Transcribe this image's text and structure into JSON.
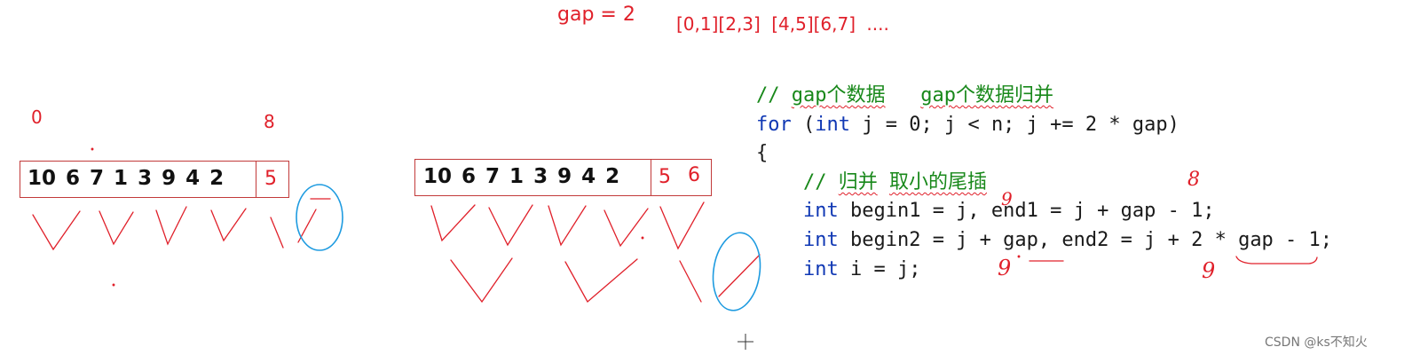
{
  "header": {
    "gap_label": "gap = 2",
    "ranges": [
      "[0,1]",
      "[2,3]",
      "[4,5]",
      "[6,7]",
      "...."
    ]
  },
  "indices": {
    "start": "0",
    "end": "8"
  },
  "array1": {
    "values": [
      "10",
      "6",
      "7",
      "1",
      "3",
      "9",
      "4",
      "2"
    ],
    "tail": [
      "5"
    ]
  },
  "array2": {
    "values": [
      "10",
      "6",
      "7",
      "1",
      "3",
      "9",
      "4",
      "2"
    ],
    "tail": [
      "5",
      "6"
    ]
  },
  "code": {
    "comment1_prefix": "// ",
    "comment1_a": "gap个数据",
    "comment1_sep": "   ",
    "comment1_b": "gap个数据归并",
    "for_kw": "for",
    "for_open": " (",
    "for_int": "int",
    "for_rest": " j = 0; j < n; j += 2 * gap)",
    "brace": "{",
    "comment2_prefix": "    // ",
    "comment2_a": "归并",
    "comment2_sep": " ",
    "comment2_b": "取小的尾插",
    "indent": "    ",
    "l4_int": "int",
    "l4_rest": " begin1 = j, end1 = j + gap - 1;",
    "l5_int": "int",
    "l5_rest": " begin2 = j + gap, end2 = j + 2 * gap - 1;",
    "l6_int": "int",
    "l6_rest": " i = j;"
  },
  "annotations": {
    "hand_8": "8",
    "hand_9a": "9",
    "hand_9b": "9",
    "hand_9c": "9"
  },
  "colors": {
    "ink_red": "#e0202a",
    "ink_blue": "#1e9be0",
    "comment_green": "#18881a",
    "keyword_blue": "#1038b4"
  },
  "watermark": "CSDN @ks不知火"
}
